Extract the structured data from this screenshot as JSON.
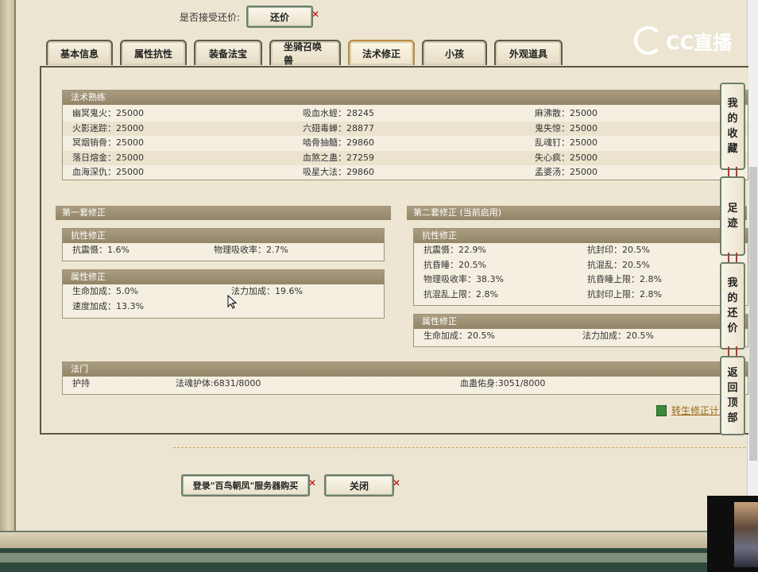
{
  "accept": {
    "label": "是否接受还价:",
    "button": "还价"
  },
  "logo": {
    "text": "CC直播"
  },
  "tabs": [
    {
      "label": "基本信息",
      "active": false
    },
    {
      "label": "属性抗性",
      "active": false
    },
    {
      "label": "装备法宝",
      "active": false
    },
    {
      "label": "坐骑召唤兽",
      "active": false
    },
    {
      "label": "法术修正",
      "active": true
    },
    {
      "label": "小孩",
      "active": false
    },
    {
      "label": "外观道具",
      "active": false
    }
  ],
  "skills": {
    "title": "法术熟练",
    "rows": [
      [
        "幽冥鬼火：25000",
        "吸血水蛭：28245",
        "麻沸散：25000"
      ],
      [
        "火影迷踪：25000",
        "六翅毒蝉：28877",
        "鬼失惊：25000"
      ],
      [
        "冥烟销骨：25000",
        "啮骨抽髓：29860",
        "乱魂钉：25000"
      ],
      [
        "落日熔金：25000",
        "血煞之蛊：27259",
        "失心疯：25000"
      ],
      [
        "血海深仇：25000",
        "吸星大法：29860",
        "孟婆汤：25000"
      ]
    ]
  },
  "set1": {
    "title": "第一套修正",
    "resist": {
      "title": "抗性修正",
      "rows": [
        [
          "抗震慑：1.6%",
          "物理吸收率：2.7%"
        ]
      ]
    },
    "attr": {
      "title": "属性修正",
      "rows": [
        [
          "生命加成：5.0%",
          "法力加成：19.6%"
        ],
        [
          "速度加成：13.3%",
          ""
        ]
      ]
    }
  },
  "set2": {
    "title": "第二套修正 (当前启用)",
    "resist": {
      "title": "抗性修正",
      "rows": [
        [
          "抗震慑：22.9%",
          "抗封印：20.5%"
        ],
        [
          "抗昏睡：20.5%",
          "抗混乱：20.5%"
        ],
        [
          "物理吸收率：38.3%",
          "抗昏睡上限：2.8%"
        ],
        [
          "抗混乱上限：2.8%",
          "抗封印上限：2.8%"
        ]
      ]
    },
    "attr": {
      "title": "属性修正",
      "rows": [
        [
          "生命加成：20.5%",
          "法力加成：20.5%"
        ]
      ]
    }
  },
  "famen": {
    "title": "法门",
    "items": [
      "护持",
      "法魂护体:6831/8000",
      "血蛊佑身:3051/8000"
    ]
  },
  "calc_link": "转生修正计算",
  "sidebar": {
    "favorites": [
      "我",
      "的",
      "收",
      "藏"
    ],
    "footprint": [
      "足",
      "迹"
    ],
    "mybids": [
      "我",
      "的",
      "还",
      "价"
    ],
    "top": [
      "返",
      "回",
      "顶",
      "部"
    ]
  },
  "bottom": {
    "login_button": "登录\"百鸟朝凤\"服务器购买",
    "close_button": "关闭"
  }
}
